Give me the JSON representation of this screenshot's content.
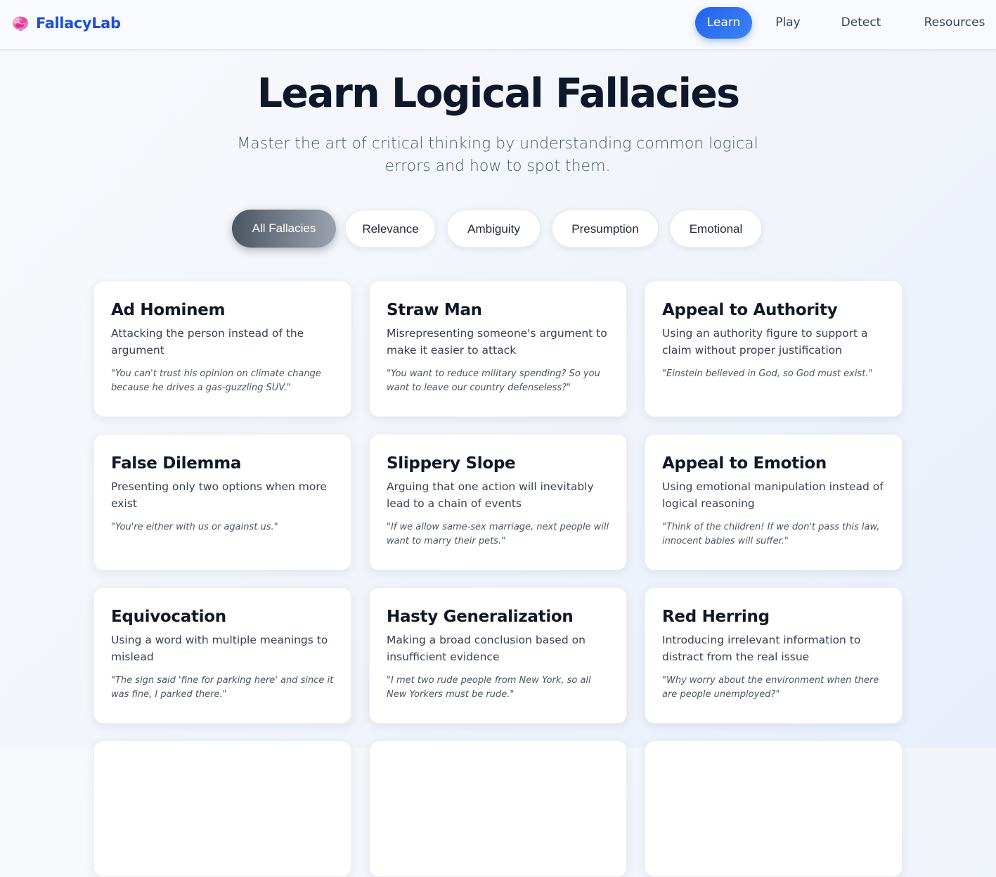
{
  "brand": {
    "icon": "brain-icon",
    "name": "FallacyLab"
  },
  "nav": {
    "learn": "Learn",
    "play": "Play",
    "detect": "Detect",
    "resources": "Resources",
    "active": "Learn"
  },
  "hero": {
    "title": "Learn Logical Fallacies",
    "subtitle": "Master the art of critical thinking by understanding common logical errors and how to spot them."
  },
  "filters": {
    "all": "All Fallacies",
    "relevance": "Relevance",
    "ambiguity": "Ambiguity",
    "presumption": "Presumption",
    "emotional": "Emotional",
    "active": "All Fallacies"
  },
  "fallacies": [
    {
      "title": "Ad Hominem",
      "description": "Attacking the person instead of the argument",
      "example": "\"You can't trust his opinion on climate change because he drives a gas-guzzling SUV.\""
    },
    {
      "title": "Straw Man",
      "description": "Misrepresenting someone's argument to make it easier to attack",
      "example": "\"You want to reduce military spending? So you want to leave our country defenseless?\""
    },
    {
      "title": "Appeal to Authority",
      "description": "Using an authority figure to support a claim without proper justification",
      "example": "\"Einstein believed in God, so God must exist.\""
    },
    {
      "title": "False Dilemma",
      "description": "Presenting only two options when more exist",
      "example": "\"You're either with us or against us.\""
    },
    {
      "title": "Slippery Slope",
      "description": "Arguing that one action will inevitably lead to a chain of events",
      "example": "\"If we allow same-sex marriage, next people will want to marry their pets.\""
    },
    {
      "title": "Appeal to Emotion",
      "description": "Using emotional manipulation instead of logical reasoning",
      "example": "\"Think of the children! If we don't pass this law, innocent babies will suffer.\""
    },
    {
      "title": "Equivocation",
      "description": "Using a word with multiple meanings to mislead",
      "example": "\"The sign said 'fine for parking here' and since it was fine, I parked there.\""
    },
    {
      "title": "Hasty Generalization",
      "description": "Making a broad conclusion based on insufficient evidence",
      "example": "\"I met two rude people from New York, so all New Yorkers must be rude.\""
    },
    {
      "title": "Red Herring",
      "description": "Introducing irrelevant information to distract from the real issue",
      "example": "\"Why worry about the environment when there are people unemployed?\""
    },
    {
      "title": "",
      "description": "",
      "example": ""
    },
    {
      "title": "",
      "description": "",
      "example": ""
    },
    {
      "title": "",
      "description": "",
      "example": ""
    }
  ],
  "colors": {
    "brand": "#1d4ed8",
    "nav_active": "#2563eb",
    "filter_active_start": "#4b5563",
    "filter_active_end": "#9ca3af",
    "title": "#0f172a"
  }
}
